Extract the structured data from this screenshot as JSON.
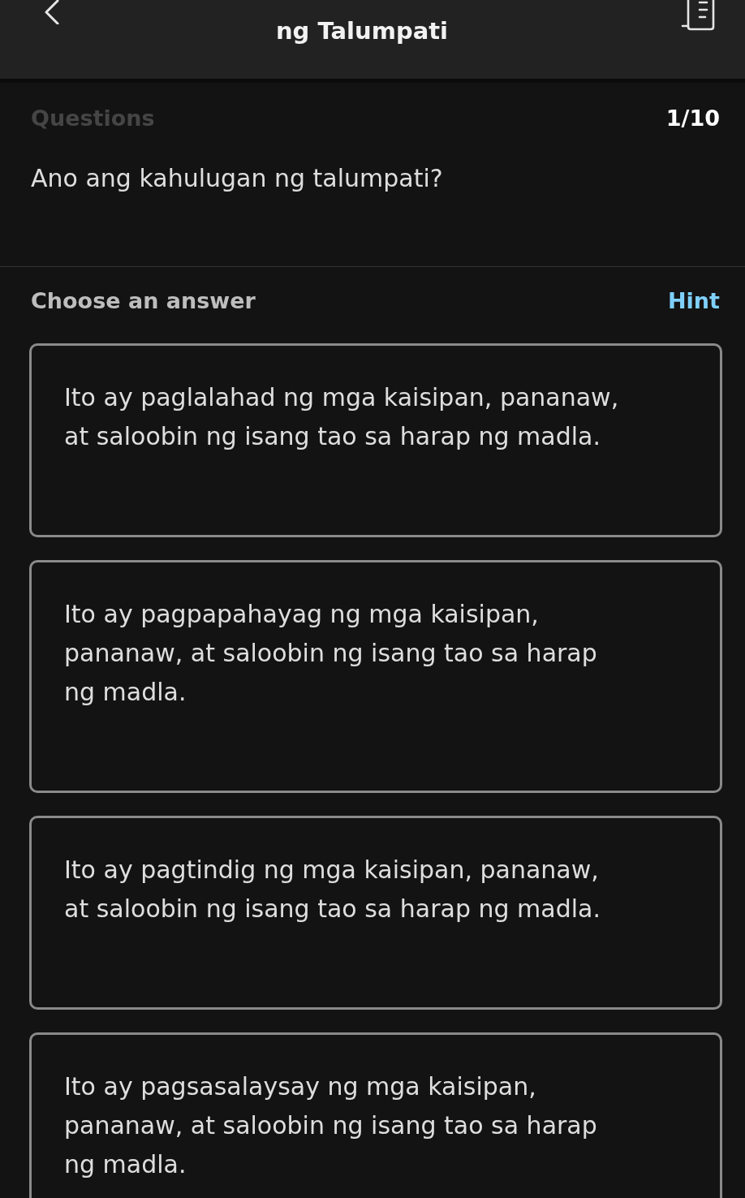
{
  "header": {
    "title": "ng Talumpati"
  },
  "questions": {
    "label": "Questions",
    "counter": "1/10",
    "question": "Ano ang kahulugan ng talumpati?"
  },
  "answers": {
    "label": "Choose an answer",
    "hint": "Hint",
    "options": [
      {
        "text": "Ito ay paglalahad ng mga kaisipan, pananaw, at saloobin ng isang tao sa harap ng madla.",
        "selected": false
      },
      {
        "text": "Ito ay pagpapahayag ng mga kaisipan, pananaw, at saloobin ng isang tao sa harap ng madla.",
        "selected": false
      },
      {
        "text": "Ito ay pagtindig ng mga kaisipan, pananaw, at saloobin ng isang tao sa harap ng madla.",
        "selected": false
      },
      {
        "text": "Ito ay pagsasalaysay ng mga kaisipan, pananaw, at saloobin ng isang tao sa harap ng madla.",
        "selected": false
      }
    ]
  }
}
